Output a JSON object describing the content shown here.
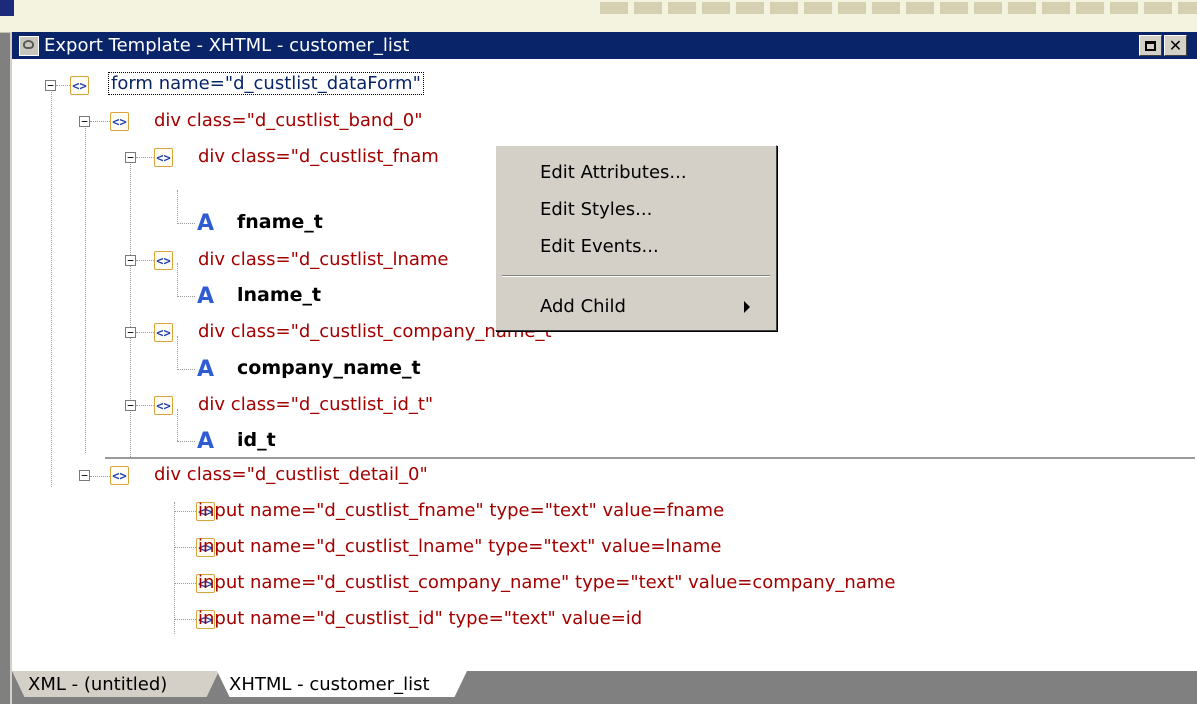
{
  "window": {
    "title": "Export Template - XHTML - customer_list"
  },
  "tree": {
    "root": "form name=\"d_custlist_dataForm\"",
    "band": "div class=\"d_custlist_band_0\"",
    "fname_div": "div class=\"d_custlist_fnam",
    "fname_text": "fname_t",
    "lname_div": "div class=\"d_custlist_lname",
    "lname_text": "lname_t",
    "company_div": "div class=\"d_custlist_company_name_t\"",
    "company_text": "company_name_t",
    "id_div": "div class=\"d_custlist_id_t\"",
    "id_text": "id_t",
    "detail": "div class=\"d_custlist_detail_0\"",
    "input_fname": "input name=\"d_custlist_fname\" type=\"text\" value=fname",
    "input_lname": "input name=\"d_custlist_lname\" type=\"text\" value=lname",
    "input_company": "input name=\"d_custlist_company_name\" type=\"text\" value=company_name",
    "input_id": "input name=\"d_custlist_id\" type=\"text\" value=id"
  },
  "context_menu": {
    "edit_attributes": "Edit Attributes...",
    "edit_styles": "Edit Styles...",
    "edit_events": "Edit Events...",
    "add_child": "Add Child"
  },
  "tabs": {
    "tab1": "XML - (untitled)",
    "tab2": "XHTML - customer_list"
  },
  "toggle_glyph": "−",
  "a_glyph": "A",
  "el_glyph": "<>"
}
